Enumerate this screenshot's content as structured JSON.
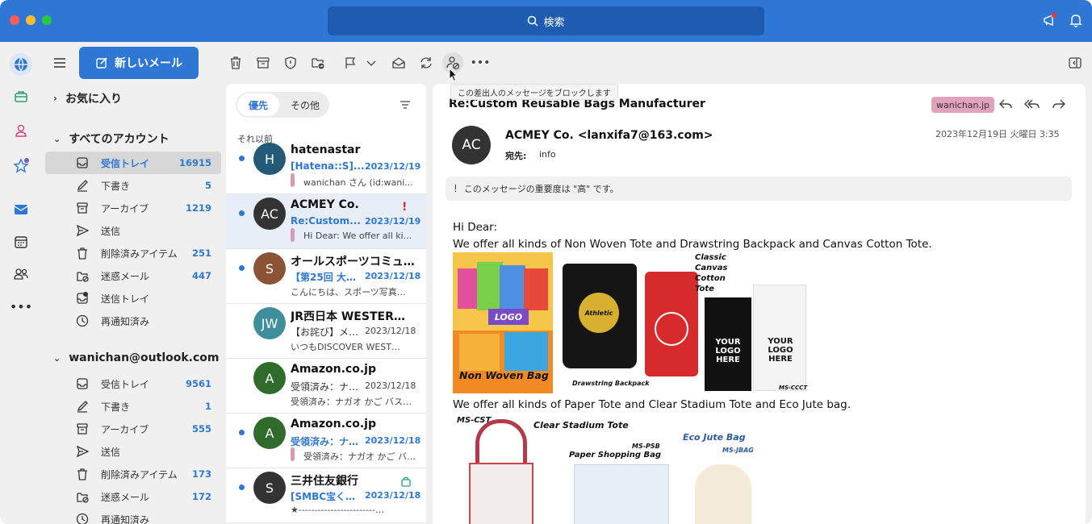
{
  "titlebar": {
    "search_label": "検索"
  },
  "toolbar": {
    "new_mail_label": "新しいメール",
    "tooltip": "この差出人のメッセージをブロックします"
  },
  "sidebar": {
    "favorites_label": "お気に入り",
    "all_accounts_label": "すべてのアカウント",
    "folders1": [
      {
        "label": "受信トレイ",
        "count": "16915",
        "icon": "inbox-icon"
      },
      {
        "label": "下書き",
        "count": "5",
        "icon": "draft-icon"
      },
      {
        "label": "アーカイブ",
        "count": "1219",
        "icon": "archive-icon"
      },
      {
        "label": "送信",
        "count": "",
        "icon": "send-icon"
      },
      {
        "label": "削除済みアイテム",
        "count": "251",
        "icon": "trash-icon"
      },
      {
        "label": "迷惑メール",
        "count": "447",
        "icon": "junk-icon"
      },
      {
        "label": "送信トレイ",
        "count": "",
        "icon": "outbox-icon"
      },
      {
        "label": "再通知済み",
        "count": "",
        "icon": "clock-icon"
      }
    ],
    "account_label": "wanichan@outlook.com",
    "folders2": [
      {
        "label": "受信トレイ",
        "count": "9561",
        "icon": "inbox-icon"
      },
      {
        "label": "下書き",
        "count": "1",
        "icon": "draft-icon"
      },
      {
        "label": "アーカイブ",
        "count": "555",
        "icon": "archive-icon"
      },
      {
        "label": "送信",
        "count": "",
        "icon": "send-icon"
      },
      {
        "label": "削除済みアイテム",
        "count": "173",
        "icon": "trash-icon"
      },
      {
        "label": "迷惑メール",
        "count": "172",
        "icon": "junk-icon"
      },
      {
        "label": "再通知済み",
        "count": "",
        "icon": "clock-icon"
      }
    ]
  },
  "list": {
    "tab_focused": "優先",
    "tab_other": "その他",
    "group_label": "それ以前",
    "messages": [
      {
        "initials": "H",
        "sender": "hatenastar",
        "subject": "[Hatena::S]...",
        "date": "2023/12/19",
        "preview": "wanichan さん (id:wani...",
        "unread": true,
        "color": "#235a77"
      },
      {
        "initials": "AC",
        "sender": "ACMEY Co.",
        "subject": "Re:Custom...",
        "date": "2023/12/19",
        "preview": "Hi Dear: We offer all ki...",
        "unread": true,
        "color": "#333333"
      },
      {
        "initials": "S",
        "sender": "オールスポーツコミュ…",
        "subject": "【第25回 大…",
        "date": "2023/12/18",
        "preview": "こんにちは、スポーツ写真…",
        "unread": true,
        "color": "#8b5535"
      },
      {
        "initials": "JW",
        "sender": "JR西日本 WESTER…",
        "subject": "【お詫び】メー…",
        "date": "2023/12/18",
        "preview": "いつもDISCOVER WEST…",
        "unread": false,
        "color": "#3e8e9b"
      },
      {
        "initials": "A",
        "sender": "Amazon.co.jp",
        "subject": "受領済み：ナ…",
        "date": "2023/12/18",
        "preview": "受領済み：ナガオ かご バス…",
        "unread": false,
        "color": "#2f6b2a"
      },
      {
        "initials": "A",
        "sender": "Amazon.co.jp",
        "subject": "受領済み：ナ…",
        "date": "2023/12/18",
        "preview": "受領済み：ナガオ かご バス…",
        "unread": true,
        "color": "#2f6b2a"
      },
      {
        "initials": "S",
        "sender": "三井住友銀行",
        "subject": "[SMBC宝く…",
        "date": "2023/12/18",
        "preview": "★------------------------…",
        "unread": true,
        "color": "#333333"
      }
    ]
  },
  "reading": {
    "subject": "Re:Custom Reusable Bags Manufacturer",
    "tag": "wanichan.jp",
    "initials": "AC",
    "from": "ACMEY Co. <lanxifa7@163.com>",
    "date": "2023年12月19日 火曜日 3:35",
    "to_label": "宛先:",
    "to_value": "info",
    "importance": "このメッセージの重要度は \"高\" です。",
    "greeting": "Hi Dear:",
    "line1": "We offer all kinds of Non Woven Tote and Drawstring Backpack and Canvas Cotton Tote.",
    "line2": "We offer all kinds of Paper Tote and Clear Stadium Tote and Eco Jute bag.",
    "img1": {
      "logo": "LOGO",
      "nonwoven": "Non Woven Bag",
      "athletic": "Athletic",
      "drawstring": "Drawstring Backpack",
      "classic": "Classic Canvas Cotton Tote",
      "your_logo": "YOUR LOGO HERE",
      "code": "MS-CCCT"
    },
    "img2": {
      "cst": "MS-CST",
      "clear": "Clear Stadium Tote",
      "psb": "MS-PSB",
      "paper": "Paper Shopping Bag",
      "eco": "Eco Jute Bag",
      "jbag": "MS-JBAG"
    }
  }
}
